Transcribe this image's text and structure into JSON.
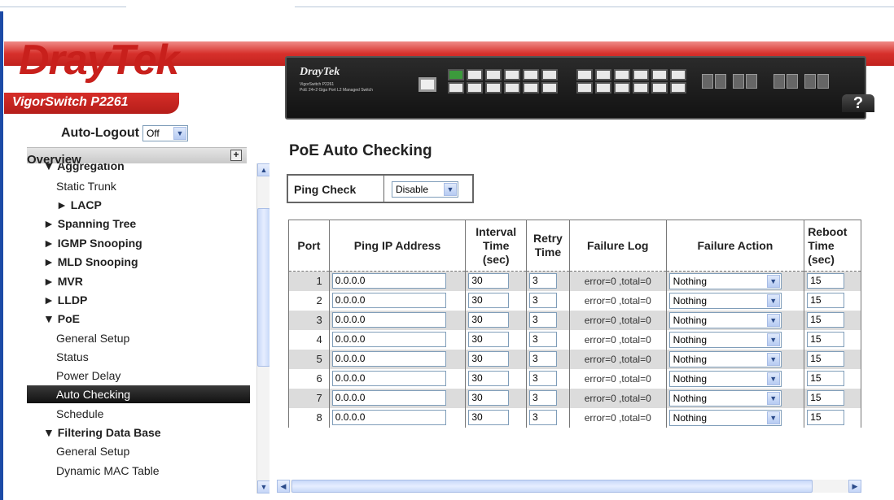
{
  "brand": {
    "logo_dray": "Dray",
    "logo_tek": "Tek",
    "model": "VigorSwitch P2261",
    "device_brand": "DrayTek",
    "device_model_line1": "VigorSwitch P2261",
    "device_model_line2": "PoE 24+2 Giga Port L2 Managed Switch",
    "help_label": "?"
  },
  "colors": {
    "brand_red": "#c8201c",
    "active_nav_bg": "#1e1e1e",
    "odd_row_bg": "#dcdcdc"
  },
  "auto_logout": {
    "label": "Auto-Logout",
    "value": "Off"
  },
  "overview": {
    "label": "Overview",
    "expand_icon": "plus-icon"
  },
  "nav": {
    "items": [
      {
        "label": "▼ Aggregation"
      },
      {
        "label": "Static Trunk"
      },
      {
        "label": "► LACP"
      },
      {
        "label": "► Spanning Tree"
      },
      {
        "label": "► IGMP Snooping"
      },
      {
        "label": "► MLD Snooping"
      },
      {
        "label": "► MVR"
      },
      {
        "label": "► LLDP"
      },
      {
        "label": "▼ PoE"
      },
      {
        "label": "General Setup"
      },
      {
        "label": "Status"
      },
      {
        "label": "Power Delay"
      },
      {
        "label": "Auto Checking"
      },
      {
        "label": "Schedule"
      },
      {
        "label": "▼ Filtering Data Base"
      },
      {
        "label": "General Setup"
      },
      {
        "label": "Dynamic MAC Table"
      }
    ]
  },
  "main": {
    "title": "PoE Auto Checking",
    "ping_check": {
      "label": "Ping Check",
      "value": "Disable"
    },
    "columns": {
      "port": "Port",
      "ping_ip": "Ping IP Address",
      "interval": "Interval Time (sec)",
      "retry": "Retry Time",
      "failure_log": "Failure Log",
      "failure_action": "Failure Action",
      "reboot": "Reboot Time (sec)"
    },
    "rows": [
      {
        "port": "1",
        "ip": "0.0.0.0",
        "interval": "30",
        "retry": "3",
        "log": "error=0 ,total=0",
        "action": "Nothing",
        "reboot": "15"
      },
      {
        "port": "2",
        "ip": "0.0.0.0",
        "interval": "30",
        "retry": "3",
        "log": "error=0 ,total=0",
        "action": "Nothing",
        "reboot": "15"
      },
      {
        "port": "3",
        "ip": "0.0.0.0",
        "interval": "30",
        "retry": "3",
        "log": "error=0 ,total=0",
        "action": "Nothing",
        "reboot": "15"
      },
      {
        "port": "4",
        "ip": "0.0.0.0",
        "interval": "30",
        "retry": "3",
        "log": "error=0 ,total=0",
        "action": "Nothing",
        "reboot": "15"
      },
      {
        "port": "5",
        "ip": "0.0.0.0",
        "interval": "30",
        "retry": "3",
        "log": "error=0 ,total=0",
        "action": "Nothing",
        "reboot": "15"
      },
      {
        "port": "6",
        "ip": "0.0.0.0",
        "interval": "30",
        "retry": "3",
        "log": "error=0 ,total=0",
        "action": "Nothing",
        "reboot": "15"
      },
      {
        "port": "7",
        "ip": "0.0.0.0",
        "interval": "30",
        "retry": "3",
        "log": "error=0 ,total=0",
        "action": "Nothing",
        "reboot": "15"
      },
      {
        "port": "8",
        "ip": "0.0.0.0",
        "interval": "30",
        "retry": "3",
        "log": "error=0 ,total=0",
        "action": "Nothing",
        "reboot": "15"
      }
    ]
  }
}
